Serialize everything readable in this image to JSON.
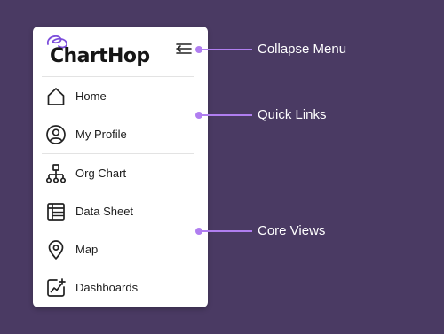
{
  "sidebar": {
    "brand": "ChartHop",
    "items": [
      {
        "label": "Home",
        "icon": "home-icon"
      },
      {
        "label": "My Profile",
        "icon": "user-circle-icon"
      },
      {
        "label": "Org Chart",
        "icon": "org-chart-icon"
      },
      {
        "label": "Data Sheet",
        "icon": "table-icon"
      },
      {
        "label": "Map",
        "icon": "map-pin-icon"
      },
      {
        "label": "Dashboards",
        "icon": "chart-line-icon"
      }
    ]
  },
  "callouts": {
    "collapse_menu": "Collapse Menu",
    "quick_links": "Quick Links",
    "core_views": "Core Views"
  },
  "colors": {
    "background": "#4a3a63",
    "accent": "#b07ef0",
    "logo_mark": "#7c4ddb"
  }
}
